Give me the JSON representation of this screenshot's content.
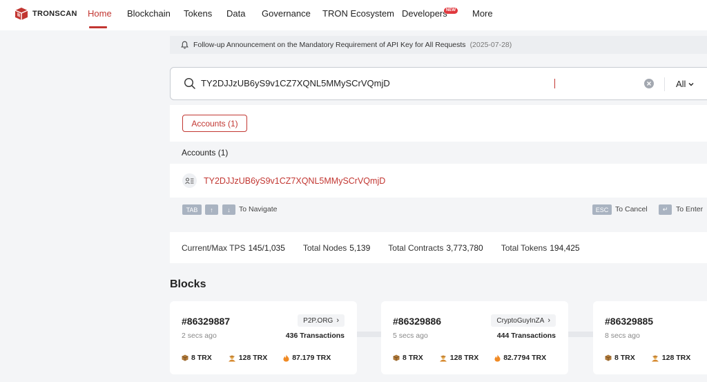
{
  "nav": {
    "logo_text": "TRONSCAN",
    "items": [
      "Home",
      "Blockchain",
      "Tokens",
      "Data",
      "Governance",
      "TRON Ecosystem",
      "Developers",
      "More"
    ],
    "new_badge": "NEW",
    "active_color": "#c23631"
  },
  "announcement": {
    "text": "Follow-up Announcement on the Mandatory Requirement of API Key for All Requests",
    "date": "(2025-07-28)"
  },
  "search": {
    "value": "TY2DJJzUB6yS9v1CZ7XQNL5MMySCrVQmjD",
    "filter": "All"
  },
  "results": {
    "pill": "Accounts (1)",
    "section_title": "Accounts (1)",
    "account": "TY2DJJzUB6yS9v1CZ7XQNL5MMySCrVQmjD",
    "hints": {
      "tab": "TAB",
      "up": "↑",
      "down": "↓",
      "navigate": "To Navigate",
      "esc": "ESC",
      "cancel": "To Cancel",
      "enter_key": "↵",
      "enter": "To Enter"
    }
  },
  "stats": {
    "tps_label": "Current/Max TPS",
    "tps_value": "145/1,035",
    "nodes_label": "Total Nodes",
    "nodes_value": "5,139",
    "contracts_label": "Total Contracts",
    "contracts_value": "3,773,780",
    "tokens_label": "Total Tokens",
    "tokens_value": "194,425"
  },
  "blocks": {
    "title": "Blocks",
    "cards": [
      {
        "num": "#86329887",
        "time": "2 secs ago",
        "producer": "P2P.ORG",
        "tx": "436 Transactions",
        "a": "8 TRX",
        "b": "128 TRX",
        "c": "87.179 TRX"
      },
      {
        "num": "#86329886",
        "time": "5 secs ago",
        "producer": "CryptoGuyInZA",
        "tx": "444 Transactions",
        "a": "8 TRX",
        "b": "128 TRX",
        "c": "82.7794 TRX"
      },
      {
        "num": "#86329885",
        "time": "8 secs ago",
        "producer": "",
        "tx": "",
        "a": "8 TRX",
        "b": "128 TRX",
        "c": ""
      }
    ]
  }
}
